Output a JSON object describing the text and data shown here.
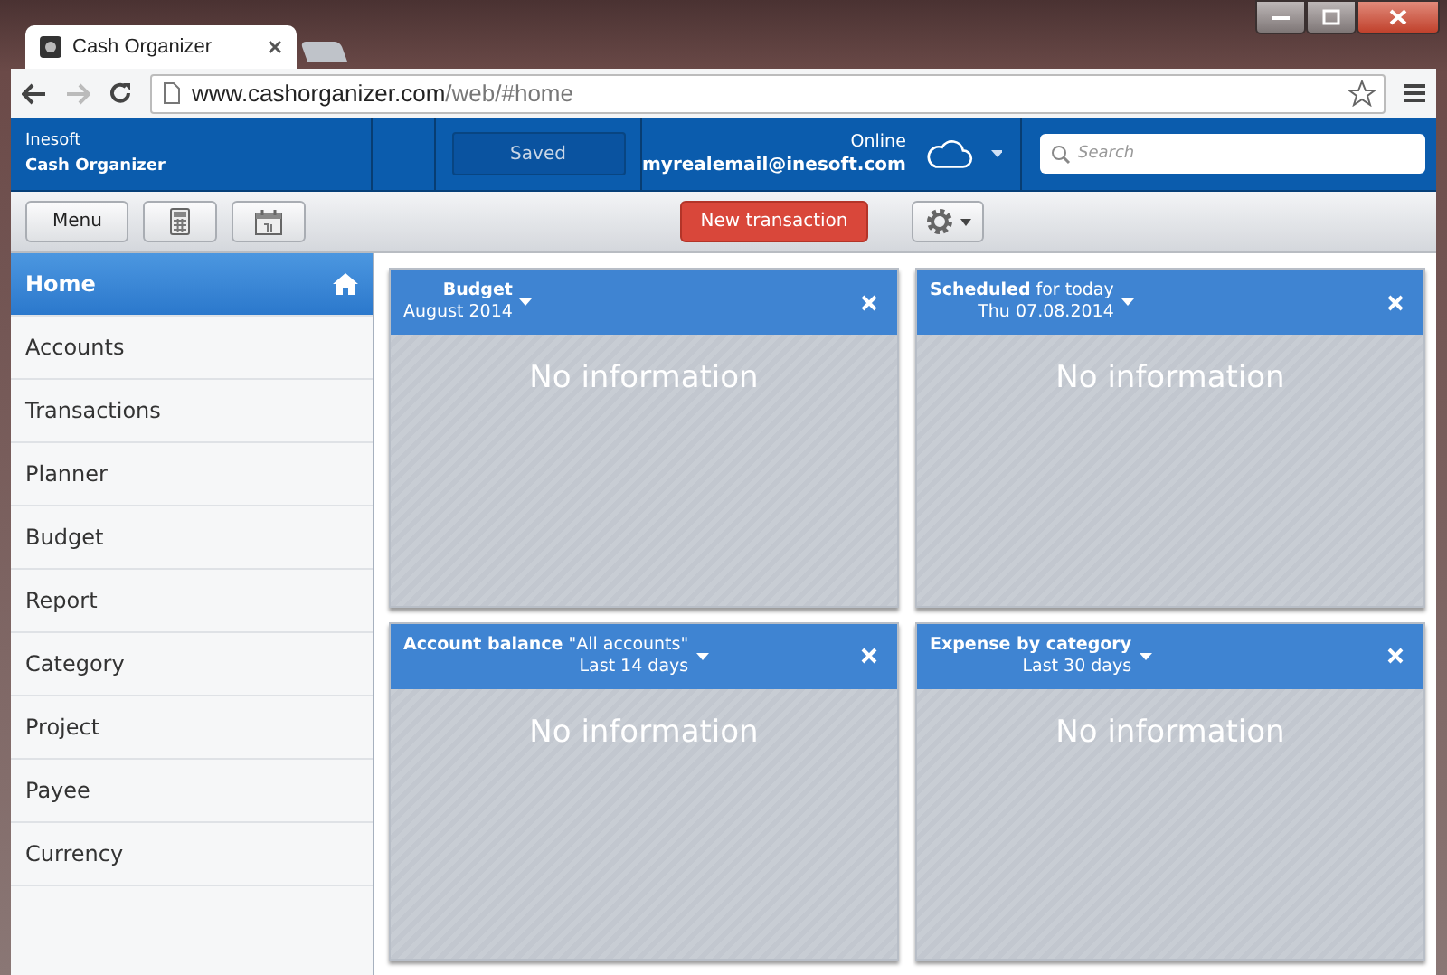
{
  "browser": {
    "tab_title": "Cash Organizer",
    "url_domain": "www.cashorganizer.com",
    "url_path": "/web/#home"
  },
  "header": {
    "company": "Inesoft",
    "app_name": "Cash Organizer",
    "save_status": "Saved",
    "connection": "Online",
    "account": "myrealemail@inesoft.com",
    "search": {
      "placeholder": "Search"
    }
  },
  "toolbar": {
    "menu": "Menu",
    "new_transaction": "New transaction"
  },
  "sidebar": {
    "items": [
      {
        "label": "Home",
        "selected": true
      },
      {
        "label": "Accounts",
        "selected": false
      },
      {
        "label": "Transactions",
        "selected": false
      },
      {
        "label": "Planner",
        "selected": false
      },
      {
        "label": "Budget",
        "selected": false
      },
      {
        "label": "Report",
        "selected": false
      },
      {
        "label": "Category",
        "selected": false
      },
      {
        "label": "Project",
        "selected": false
      },
      {
        "label": "Payee",
        "selected": false
      },
      {
        "label": "Currency",
        "selected": false
      }
    ]
  },
  "widgets": [
    {
      "title": "Budget",
      "period": "August 2014",
      "message": "No information"
    },
    {
      "title": "Scheduled",
      "qualifier": "for today",
      "period": "Thu 07.08.2014",
      "message": "No information"
    },
    {
      "title": "Account balance",
      "qualifier": "\"All accounts\"",
      "period": "Last 14 days",
      "message": "No information"
    },
    {
      "title": "Expense by category",
      "period": "Last 30 days",
      "message": "No information"
    }
  ]
}
